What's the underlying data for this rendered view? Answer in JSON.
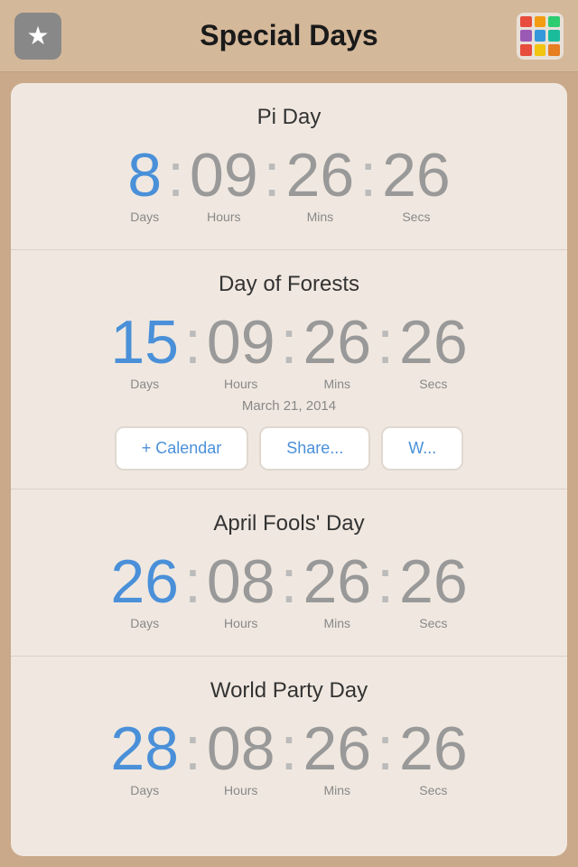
{
  "header": {
    "title": "Special Days",
    "star_icon": "★",
    "grid_colors": [
      "#e74c3c",
      "#f39c12",
      "#2ecc71",
      "#9b59b6",
      "#3498db",
      "#1abc9c",
      "#e74c3c",
      "#f1c40f",
      "#e67e22"
    ]
  },
  "events": [
    {
      "name": "Pi Day",
      "days": "8",
      "hours": "09",
      "mins": "26",
      "secs": "26",
      "days_label": "Days",
      "hours_label": "Hours",
      "mins_label": "Mins",
      "secs_label": "Secs",
      "date": null,
      "show_buttons": false
    },
    {
      "name": "Day of Forests",
      "days": "15",
      "hours": "09",
      "mins": "26",
      "secs": "26",
      "days_label": "Days",
      "hours_label": "Hours",
      "mins_label": "Mins",
      "secs_label": "Secs",
      "date": "March 21, 2014",
      "show_buttons": true
    },
    {
      "name": "April Fools' Day",
      "days": "26",
      "hours": "08",
      "mins": "26",
      "secs": "26",
      "days_label": "Days",
      "hours_label": "Hours",
      "mins_label": "Mins",
      "secs_label": "Secs",
      "date": null,
      "show_buttons": false
    },
    {
      "name": "World Party Day",
      "days": "28",
      "hours": "08",
      "mins": "26",
      "secs": "26",
      "days_label": "Days",
      "hours_label": "Hours",
      "mins_label": "Mins",
      "secs_label": "Secs",
      "date": null,
      "show_buttons": false
    }
  ],
  "buttons": {
    "calendar": "+ Calendar",
    "share": "Share...",
    "wiki": "W..."
  }
}
